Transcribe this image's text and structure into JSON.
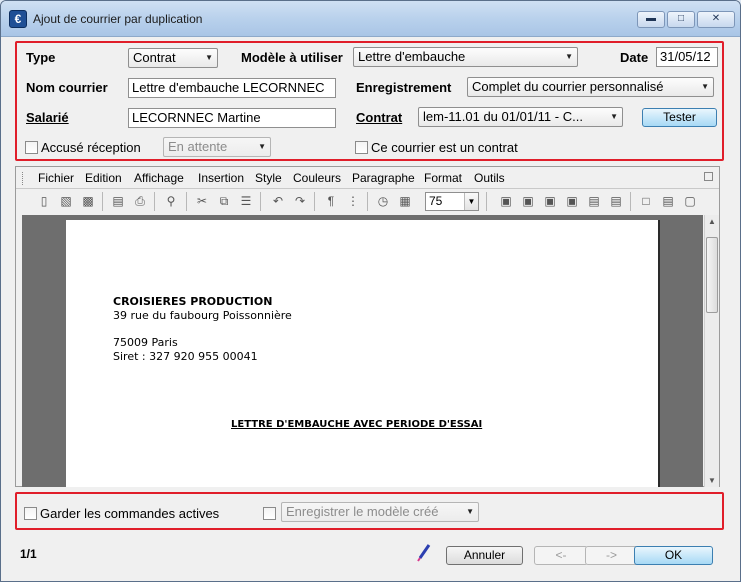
{
  "window": {
    "title": "Ajout de courrier par duplication"
  },
  "form": {
    "type_label": "Type",
    "type_value": "Contrat",
    "model_label": "Modèle à utiliser",
    "model_value": "Lettre d'embauche",
    "date_label": "Date",
    "date_value": "31/05/12",
    "name_label": "Nom courrier",
    "name_value": "Lettre d'embauche LECORNNEC",
    "save_label": "Enregistrement",
    "save_value": "Complet du courrier personnalisé",
    "employee_label": "Salarié",
    "employee_value": "LECORNNEC Martine",
    "contract_label": "Contrat",
    "contract_value": "lem-11.01 du 01/01/11 - C...",
    "test_button": "Tester",
    "receipt_label": "Accusé réception",
    "receipt_value": "En attente",
    "is_contract_label": "Ce courrier est un contrat"
  },
  "editor": {
    "menu": [
      "Fichier",
      "Edition",
      "Affichage",
      "Insertion",
      "Style",
      "Couleurs",
      "Paragraphe",
      "Format",
      "Outils"
    ],
    "zoom": "75",
    "document": {
      "company": "CROISIERES PRODUCTION",
      "address1": "39 rue du faubourg Poissonnière",
      "address2": "75009 Paris",
      "siret": "Siret : 327 920 955 00041",
      "title": "LETTRE D'EMBAUCHE AVEC PERIODE D'ESSAI"
    }
  },
  "options": {
    "keep_orders_label": "Garder les commandes actives",
    "save_model_label": "Enregistrer le modèle créé"
  },
  "footer": {
    "page_indicator": "1/1",
    "cancel": "Annuler",
    "prev": "<-",
    "next": "->",
    "ok": "OK"
  },
  "colors": {
    "highlight_border": "#e01e2a",
    "accent_button": "#a7d9f5"
  }
}
